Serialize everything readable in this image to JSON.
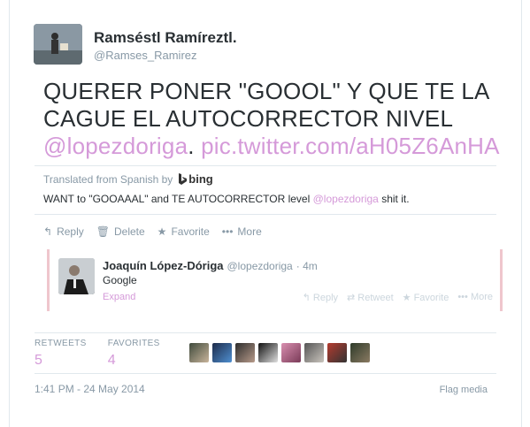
{
  "tweet": {
    "author_name": "Ramséstl Ramíreztl.",
    "author_handle": "@Ramses_Ramirez",
    "text_line1": "QUERER PONER \"GOOOL\" Y QUE TE LA",
    "text_line2": "CAGUE EL AUTOCORRECTOR NIVEL",
    "mention": "@lopezdoriga",
    "text_period": ".",
    "pic_link": "pic.twitter.com/aH05Z6AnHA",
    "translated_from": "Translated from Spanish by",
    "translator": "bing",
    "translation_pre": "WANT to \"GOOAAAL\" and TE AUTOCORRECTOR level",
    "translation_mention": "@lopezdoriga",
    "translation_post": "shit it.",
    "timestamp": "1:41 PM - 24 May 2014",
    "flag_media": "Flag media"
  },
  "actions": {
    "reply": "Reply",
    "delete": "Delete",
    "favorite": "Favorite",
    "more": "More"
  },
  "reply_tweet": {
    "author_name": "Joaquín López-Dóriga",
    "author_handle": "@lopezdoriga",
    "age": "· 4m",
    "text": "Google",
    "expand": "Expand",
    "actions": {
      "reply": "Reply",
      "retweet": "Retweet",
      "favorite": "Favorite",
      "more": "More"
    }
  },
  "stats": {
    "retweets_label": "RETWEETS",
    "retweets_value": "5",
    "favorites_label": "FAVORITES",
    "favorites_value": "4"
  },
  "colors": {
    "link": "#d59ad9",
    "muted": "#8899a6",
    "text": "#292f33",
    "reply_border": "#efc6cd"
  },
  "icons": {
    "reply": "reply-icon",
    "delete": "trash-icon",
    "favorite": "star-icon",
    "more": "ellipsis-icon",
    "retweet": "retweet-icon",
    "bing": "bing-logo-icon"
  }
}
